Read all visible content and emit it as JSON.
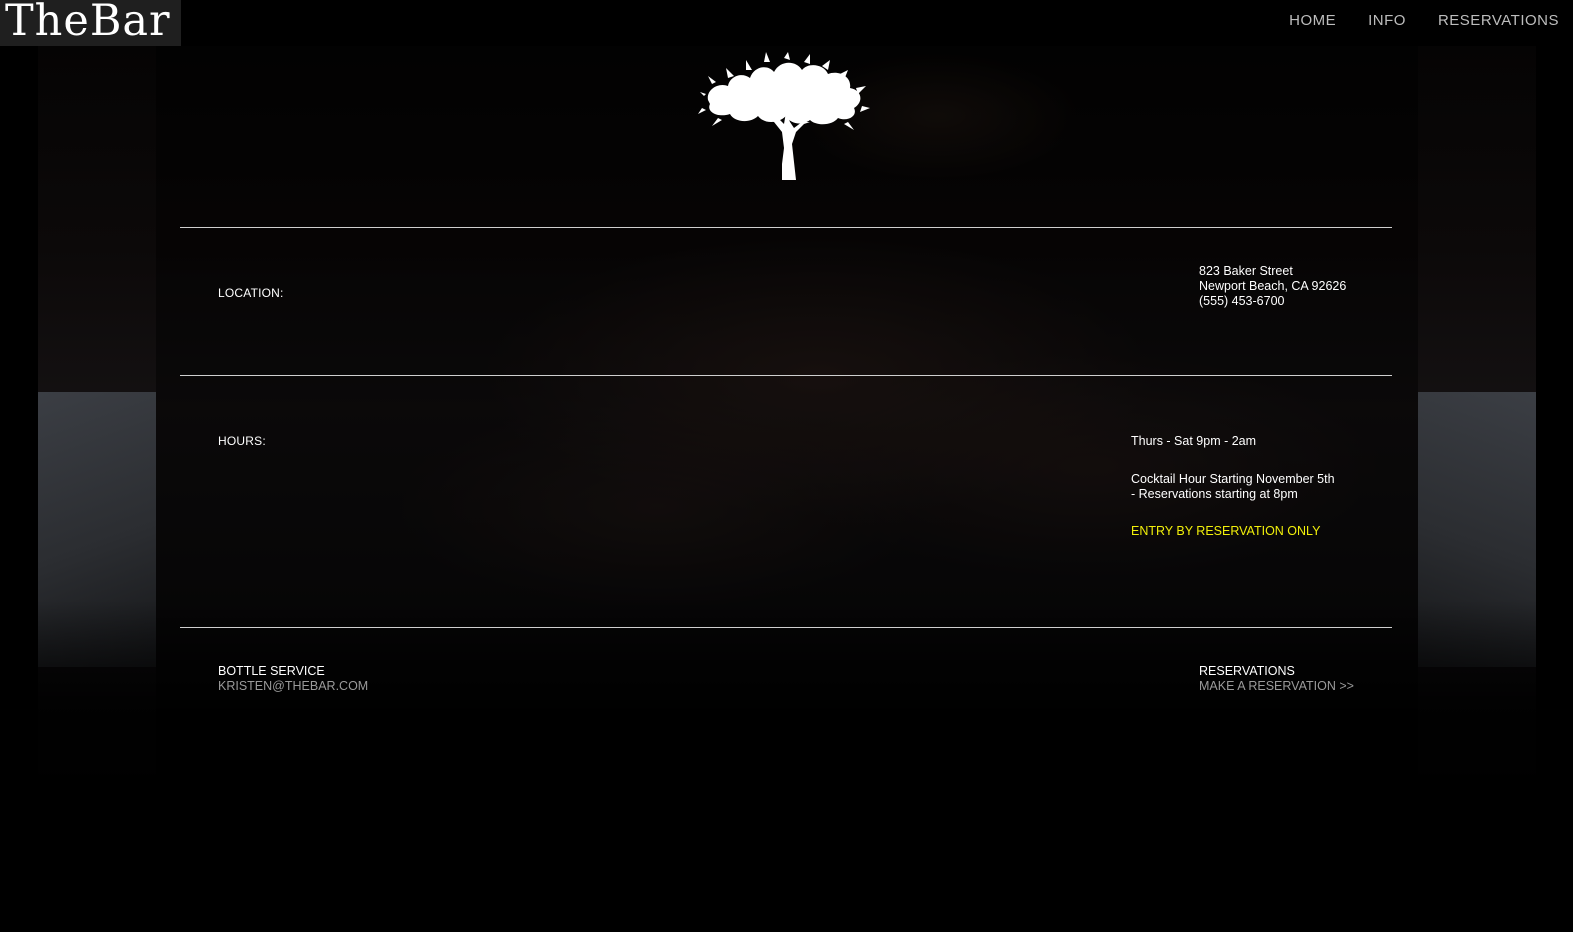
{
  "brand": {
    "logo_text": "TheBar"
  },
  "nav": {
    "items": [
      "HOME",
      "INFO",
      "RESERVATIONS"
    ]
  },
  "location": {
    "label": "LOCATION:",
    "street": "823 Baker Street",
    "city": "Newport Beach, CA 92626",
    "phone": "(555) 453-6700"
  },
  "hours": {
    "label": "HOURS:",
    "schedule": "Thurs - Sat 9pm - 2am",
    "note_line1": "Cocktail Hour Starting November 5th",
    "note_line2": "- Reservations starting at 8pm",
    "entry_notice": "ENTRY BY RESERVATION ONLY",
    "entry_color": "#f2f00a"
  },
  "bottle_service": {
    "label": "BOTTLE SERVICE",
    "email": "KRISTEN@THEBAR.COM"
  },
  "reservations": {
    "label": "RESERVATIONS",
    "link_text": "MAKE A RESERVATION >>"
  },
  "icons": {
    "logo_graphic": "tree-icon"
  }
}
